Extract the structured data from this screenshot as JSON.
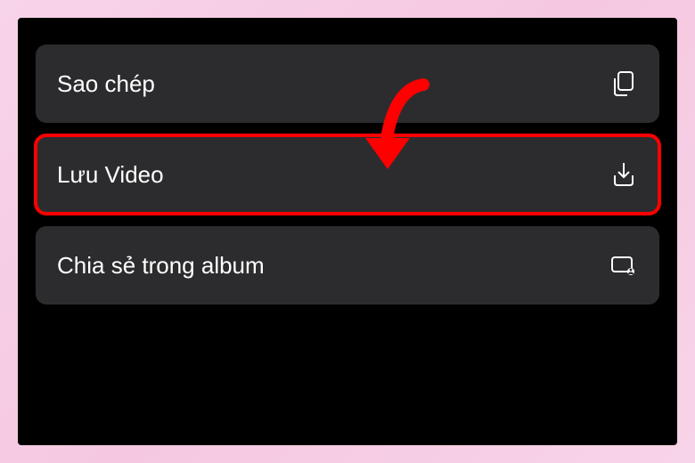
{
  "menu": {
    "items": [
      {
        "label": "Sao chép",
        "icon": "copy-icon",
        "highlighted": false
      },
      {
        "label": "Lưu Video",
        "icon": "download-icon",
        "highlighted": true
      },
      {
        "label": "Chia sẻ trong album",
        "icon": "shared-album-icon",
        "highlighted": false
      }
    ]
  },
  "annotation": {
    "arrow_color": "#ff0000",
    "highlight_color": "#ff0000"
  }
}
